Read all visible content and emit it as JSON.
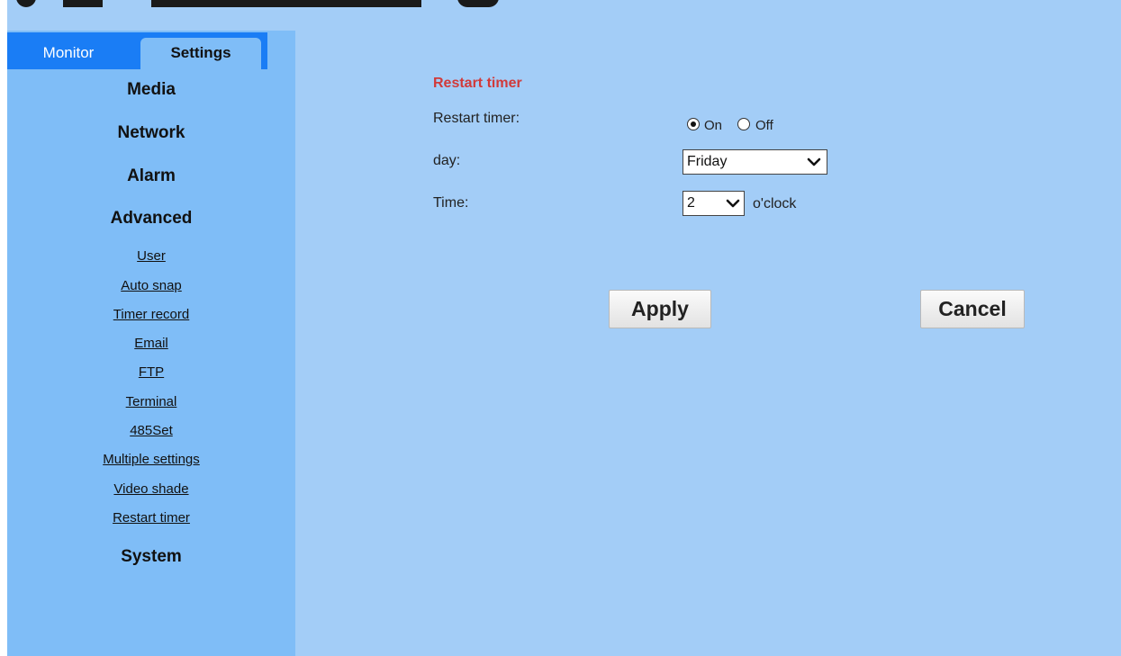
{
  "tabs": {
    "monitor": "Monitor",
    "settings": "Settings"
  },
  "menu": {
    "media": "Media",
    "network": "Network",
    "alarm": "Alarm",
    "advanced": "Advanced",
    "advanced_items": [
      "User",
      "Auto snap",
      "Timer record",
      "Email",
      "FTP",
      "Terminal",
      "485Set",
      "Multiple settings",
      "Video shade",
      "Restart timer"
    ],
    "system": "System"
  },
  "form": {
    "section_title": "Restart timer",
    "restart_label": "Restart timer:",
    "on_label": "On",
    "off_label": "Off",
    "restart_value": "On",
    "day_label": "day:",
    "day_value": "Friday",
    "time_label": "Time:",
    "time_value": "2",
    "time_unit": "o'clock"
  },
  "buttons": {
    "apply": "Apply",
    "cancel": "Cancel"
  },
  "colors": {
    "main_bg": "#a3cdf7",
    "sidebar_bg": "#7fbdf7",
    "tab_strip": "#1a7df5",
    "section_title": "#d13a3a"
  }
}
